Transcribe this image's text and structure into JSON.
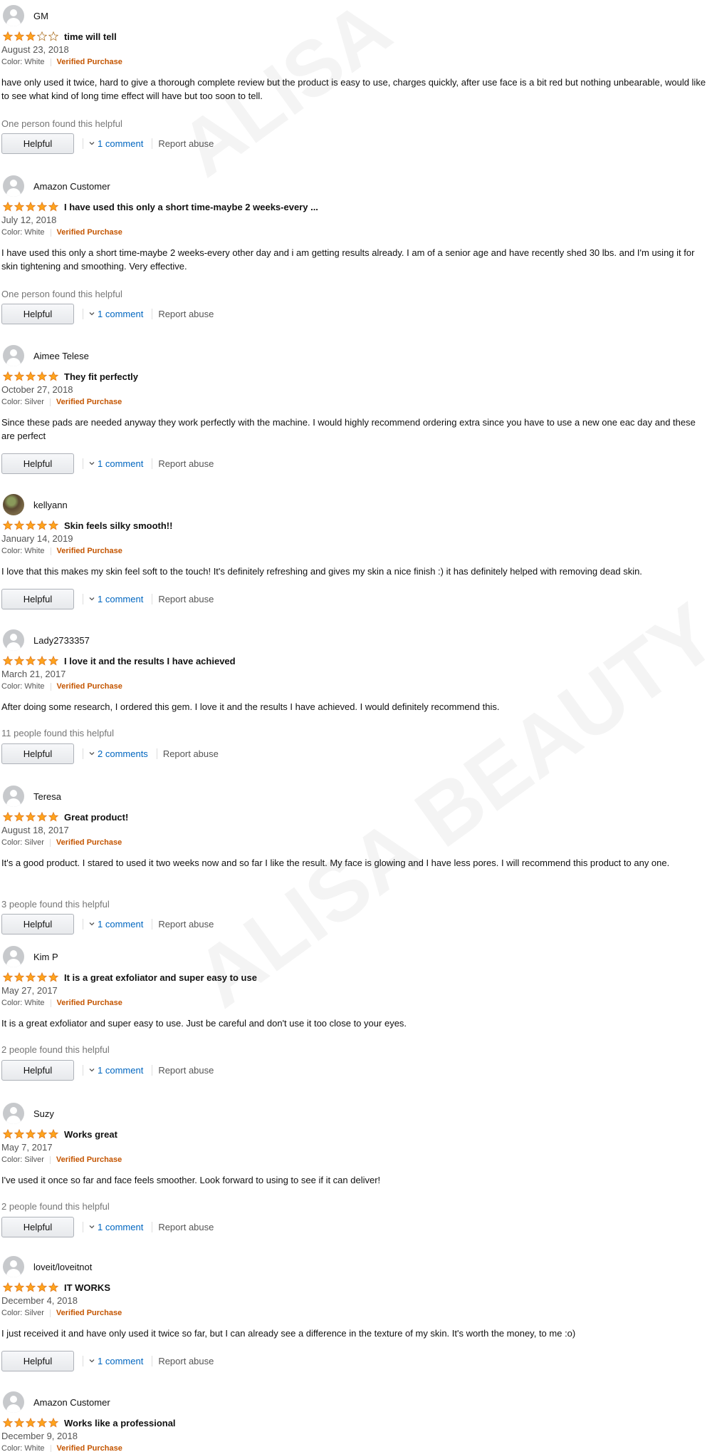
{
  "colors": {
    "star": "#ffa41c",
    "star_empty": "#ffffff",
    "verified": "#c45500",
    "link": "#0066c0"
  },
  "watermark": {
    "text_1": "ALISA",
    "text_2": "ALISA BEAUTY"
  },
  "reviews": [
    {
      "name": "GM",
      "avatar": "default-avatar",
      "rating": 3,
      "title": "time will tell",
      "date": "August 23, 2018",
      "color": "Color: White",
      "verified": "Verified Purchase",
      "body": "have only used it twice, hard to give a thorough complete review but the product is easy to use, charges quickly, after use face is a bit red but nothing unbearable, would like to see what kind of long time effect will have but too soon to tell.",
      "helpful_text": "One person found this helpful",
      "helpful_label": "Helpful",
      "comments": "1 comment",
      "report": "Report abuse"
    },
    {
      "name": "Amazon Customer",
      "avatar": "default-avatar",
      "rating": 5,
      "title": "I have used this only a short time-maybe 2 weeks-every ...",
      "date": "July 12, 2018",
      "color": "Color: White",
      "verified": "Verified Purchase",
      "body": "I have used this only a short time-maybe 2 weeks-every other day and i am getting results already. I am of a senior age and have recently shed 30 lbs. and I'm using it for skin tightening and smoothing. Very effective.",
      "helpful_text": "One person found this helpful",
      "helpful_label": "Helpful",
      "comments": "1 comment",
      "report": "Report abuse"
    },
    {
      "name": "Aimee Telese",
      "avatar": "default-avatar",
      "rating": 5,
      "title": "They fit perfectly",
      "date": "October 27, 2018",
      "color": "Color: Silver",
      "verified": "Verified Purchase",
      "body": "Since these pads are needed anyway they work perfectly with the machine. I would highly recommend ordering extra since you have to use a new one eac day and these are perfect",
      "helpful_text": "",
      "helpful_label": "Helpful",
      "comments": "1 comment",
      "report": "Report abuse"
    },
    {
      "name": "kellyann",
      "avatar": "photo-avatar",
      "rating": 5,
      "title": "Skin feels silky smooth!!",
      "date": "January 14, 2019",
      "color": "Color: White",
      "verified": "Verified Purchase",
      "body": "I love that this makes my skin feel soft to the touch! It's definitely refreshing and gives my skin a nice finish :) it has definitely helped with removing dead skin.",
      "helpful_text": "",
      "helpful_label": "Helpful",
      "comments": "1 comment",
      "report": "Report abuse"
    },
    {
      "name": "Lady2733357",
      "avatar": "default-avatar",
      "rating": 5,
      "title": "I love it and the results I have achieved",
      "date": "March 21, 2017",
      "color": "Color: White",
      "verified": "Verified Purchase",
      "body": "After doing some research, I ordered this gem. I love it and the results I have achieved. I would definitely recommend this.",
      "helpful_text": "11 people found this helpful",
      "helpful_label": "Helpful",
      "comments": "2 comments",
      "report": "Report abuse"
    },
    {
      "name": "Teresa",
      "avatar": "default-avatar",
      "rating": 5,
      "title": "Great product!",
      "date": "August 18, 2017",
      "color": "Color: Silver",
      "verified": "Verified Purchase",
      "body": "It's a good product. I stared to used it two weeks now and so far I like the result. My face is glowing and I have less pores. I will recommend this product to any one.",
      "helpful_text": "3 people found this helpful",
      "helpful_label": "Helpful",
      "comments": "1 comment",
      "report": "Report abuse"
    },
    {
      "name": "Kim P",
      "avatar": "default-avatar",
      "rating": 5,
      "title": "It is a great exfoliator and super easy to use",
      "date": "May 27, 2017",
      "color": "Color: White",
      "verified": "Verified Purchase",
      "body": "It is a great exfoliator and super easy to use. Just be careful and don't use it too close to your eyes.",
      "helpful_text": "2 people found this helpful",
      "helpful_label": "Helpful",
      "comments": "1 comment",
      "report": "Report abuse"
    },
    {
      "name": "Suzy",
      "avatar": "default-avatar",
      "rating": 5,
      "title": "Works great",
      "date": "May 7, 2017",
      "color": "Color: Silver",
      "verified": "Verified Purchase",
      "body": "I've used it once so far and face feels smoother. Look forward to using to see if it can deliver!",
      "helpful_text": "2 people found this helpful",
      "helpful_label": "Helpful",
      "comments": "1 comment",
      "report": "Report abuse"
    },
    {
      "name": "loveit/loveitnot",
      "avatar": "default-avatar",
      "rating": 5,
      "title": "IT WORKS",
      "date": "December 4, 2018",
      "color": "Color: Silver",
      "verified": "Verified Purchase",
      "body": "I just received it and have only used it twice so far, but I can already see a difference in the texture of my skin. It's worth the money, to me :o)",
      "helpful_text": "",
      "helpful_label": "Helpful",
      "comments": "1 comment",
      "report": "Report abuse"
    },
    {
      "name": "Amazon Customer",
      "avatar": "default-avatar",
      "rating": 5,
      "title": "Works like a professional",
      "date": "December 9, 2018",
      "color": "Color: White",
      "verified": "Verified Purchase",
      "body": "",
      "helpful_text": "",
      "helpful_label": "",
      "comments": "",
      "report": ""
    }
  ]
}
